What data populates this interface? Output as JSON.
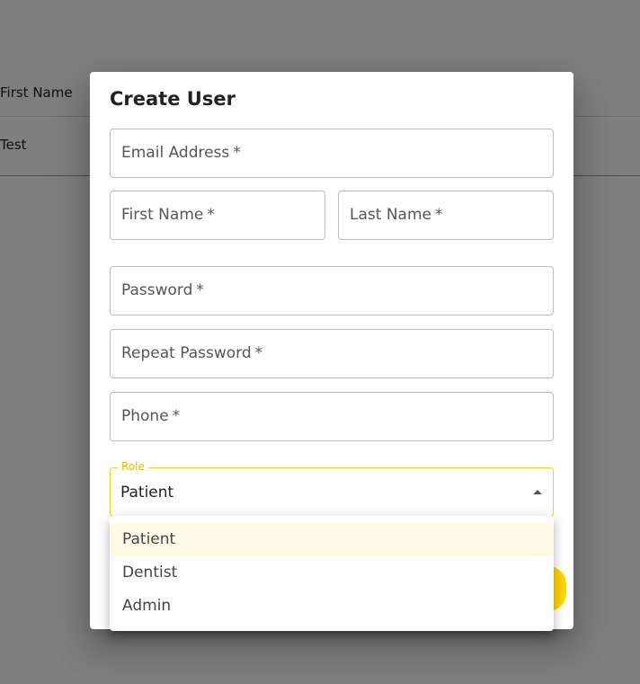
{
  "background": {
    "header": {
      "col1": "First Name"
    },
    "row1": {
      "col1": "Test"
    }
  },
  "dialog": {
    "title": "Create User",
    "fields": {
      "email": "Email Address",
      "first_name": "First Name",
      "last_name": "Last Name",
      "password": "Password",
      "repeat_password": "Repeat Password",
      "phone": "Phone",
      "required_mark": "*"
    },
    "role": {
      "label": "Role",
      "value": "Patient",
      "options": [
        "Patient",
        "Dentist",
        "Admin"
      ]
    }
  },
  "colors": {
    "accent": "#ffd600",
    "backdrop": "rgba(0,0,0,0.5)"
  }
}
